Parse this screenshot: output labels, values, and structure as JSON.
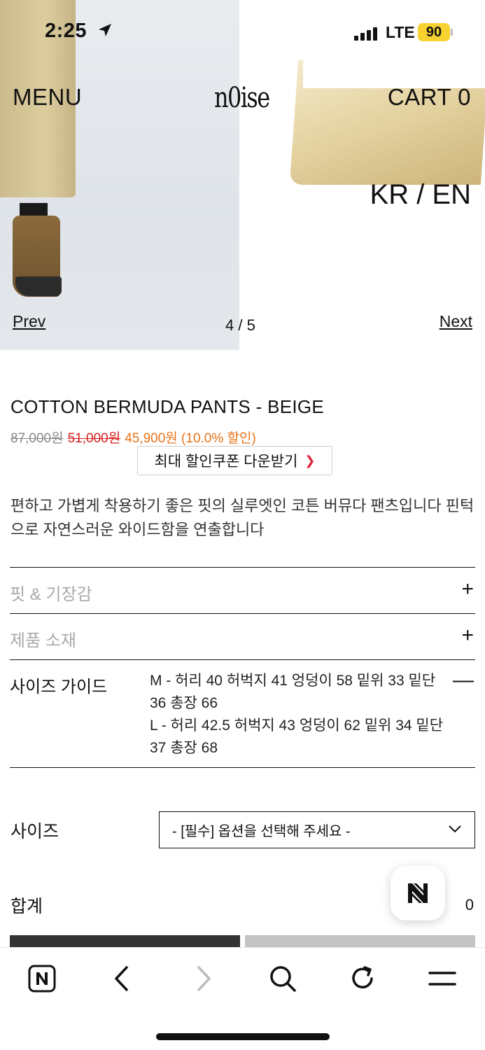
{
  "status": {
    "time": "2:25",
    "network": "LTE",
    "battery": "90"
  },
  "nav": {
    "menu": "MENU",
    "logo": "n0ise",
    "cart": "CART 0",
    "lang": "KR / EN"
  },
  "gallery": {
    "prev": "Prev",
    "counter": "4 / 5",
    "next": "Next"
  },
  "product": {
    "title": "COTTON BERMUDA PANTS - BEIGE",
    "price_original": "87,000원",
    "price_mid": "51,000원",
    "price_sale": "45,900원 (10.0% 할인)",
    "coupon_label": "최대 할인쿠폰 다운받기",
    "description": "편하고 가볍게 착용하기 좋은 핏의 실루엣인 코튼 버뮤다 팬츠입니다 핀턱으로 자연스러운 와이드함을 연출합니다"
  },
  "accordions": [
    {
      "label": "핏 & 기장감",
      "toggle": "+"
    },
    {
      "label": "제품 소재",
      "toggle": "+"
    },
    {
      "label": "사이즈 가이드",
      "toggle": "—",
      "content_m": "M - 허리 40 허벅지 41 엉덩이 58 밑위 33 밑단 36 총장 66",
      "content_l": "L - 허리 42.5 허벅지 43 엉덩이 62 밑위 34 밑단 37 총장 68"
    }
  ],
  "option": {
    "label": "사이즈",
    "placeholder": "- [필수] 옵션을 선택해 주세요 -"
  },
  "total": {
    "label": "합계",
    "value": "0"
  },
  "colors": {
    "sale": "#e8731a",
    "strike": "#d61f1f",
    "battery": "#f7d231"
  }
}
